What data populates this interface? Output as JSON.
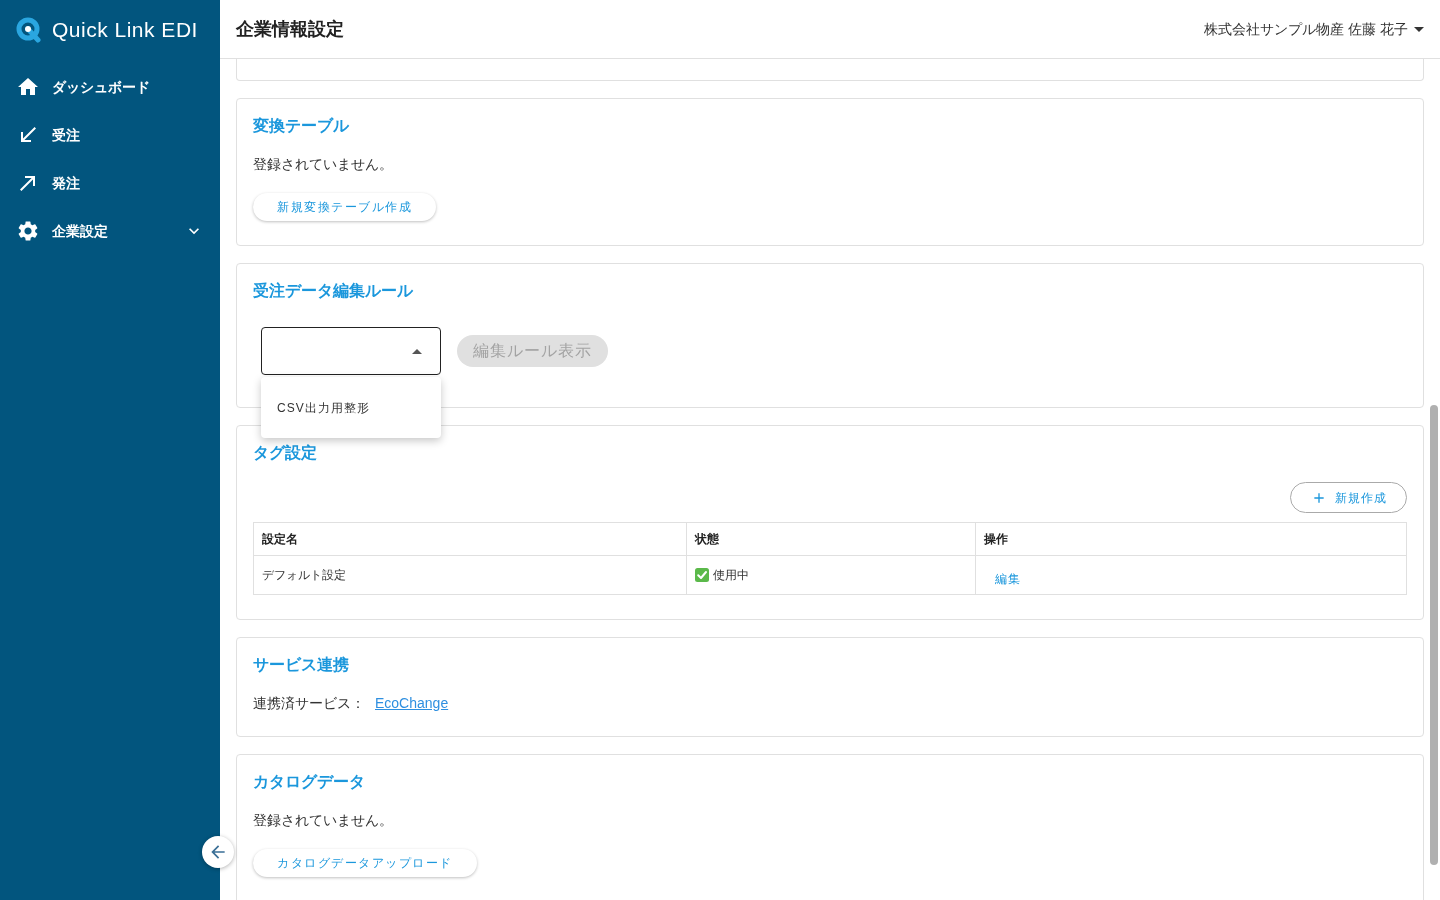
{
  "sidebar": {
    "logo": "Quick Link EDI",
    "items": [
      {
        "kind": "link",
        "label": "ダッシュボード"
      },
      {
        "kind": "link",
        "label": "受注"
      },
      {
        "kind": "link",
        "label": "発注"
      },
      {
        "kind": "group",
        "label": "企業設定",
        "expanded": false
      }
    ]
  },
  "header": {
    "title": "企業情報設定",
    "user": "株式会社サンプル物産 佐藤 花子"
  },
  "sections": [
    {
      "kind": "empty",
      "title": "変換テーブル",
      "message": "登録されていません。",
      "button": "新規変換テーブル作成"
    },
    {
      "kind": "rule_select",
      "title": "受注データ編集ルール",
      "select": {
        "expanded": true,
        "options": [
          {
            "label": "CSV出力用整形",
            "selected": false
          }
        ]
      },
      "button": {
        "label": "編集ルール表示",
        "disabled": true
      }
    },
    {
      "kind": "table",
      "title": "タグ設定",
      "add_button": "新規作成",
      "table": {
        "columns": [
          "設定名",
          "状態",
          "操作"
        ],
        "rows": [
          {
            "name": "デフォルト設定",
            "active": true,
            "status": "使用中",
            "action": "編集"
          }
        ]
      }
    },
    {
      "kind": "service",
      "title": "サービス連携",
      "label": "連携済サービス：",
      "link": "EcoChange"
    },
    {
      "kind": "empty",
      "title": "カタログデータ",
      "message": "登録されていません。",
      "button": "カタログデータアップロード"
    }
  ]
}
